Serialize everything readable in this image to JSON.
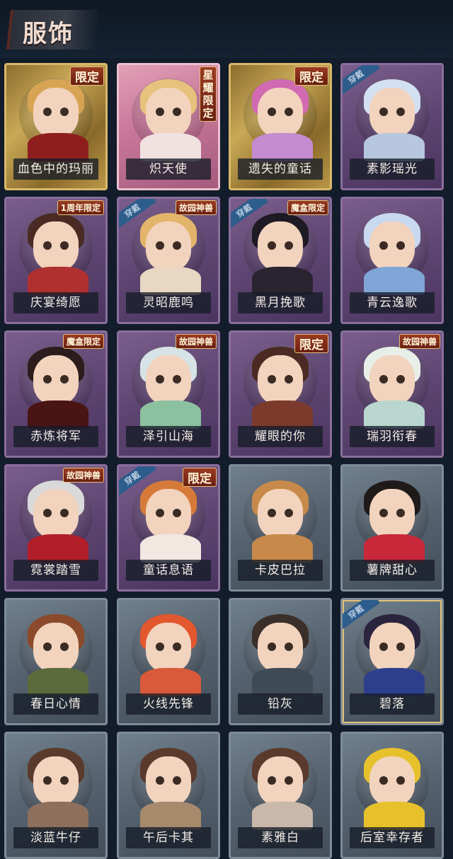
{
  "header": {
    "title": "服饰"
  },
  "cards": [
    {
      "name": "血色中的玛丽",
      "style": "gold",
      "tag": "限定",
      "hair": "#d7a454",
      "body": "#8e1e1e"
    },
    {
      "name": "炽天使",
      "style": "pink",
      "tag": "星耀限定",
      "tagVertical": true,
      "hair": "#e6c27c",
      "body": "#f1e1e1"
    },
    {
      "name": "遗失的童话",
      "style": "gold",
      "tag": "限定",
      "hair": "#d16ab2",
      "body": "#c58bd0"
    },
    {
      "name": "素影瑶光",
      "style": "purple",
      "wear": "穿戴",
      "hair": "#d3e0f2",
      "body": "#b6c7df"
    },
    {
      "name": "庆宴绮愿",
      "style": "purple",
      "tag": "1周年限定",
      "tagSmall": true,
      "hair": "#4a2b24",
      "body": "#b03030"
    },
    {
      "name": "灵昭鹿鸣",
      "style": "purple",
      "wear": "穿戴",
      "tag": "故园神兽",
      "tagSmall": true,
      "hair": "#e2b56a",
      "body": "#e8d7c2"
    },
    {
      "name": "黑月挽歌",
      "style": "purple",
      "wear": "穿戴",
      "tag": "魔盒限定",
      "tagSmall": true,
      "hair": "#1e1a24",
      "body": "#2a2330"
    },
    {
      "name": "青云逸歌",
      "style": "purple",
      "hair": "#c8d8ee",
      "body": "#7fa6d6"
    },
    {
      "name": "赤炼将军",
      "style": "purple",
      "tag": "魔盒限定",
      "tagSmall": true,
      "hair": "#2c1c1c",
      "body": "#4a1414"
    },
    {
      "name": "泽引山海",
      "style": "purple",
      "tag": "故园神兽",
      "tagSmall": true,
      "hair": "#d6e3e6",
      "body": "#8cc1a0"
    },
    {
      "name": "耀眼的你",
      "style": "purple",
      "tag": "限定",
      "hair": "#4a2a22",
      "body": "#7b3a2b"
    },
    {
      "name": "瑞羽衔春",
      "style": "purple",
      "tag": "故园神兽",
      "tagSmall": true,
      "hair": "#e8efe9",
      "body": "#b9d6cf"
    },
    {
      "name": "霓裳踏雪",
      "style": "purple",
      "tag": "故园神兽",
      "tagSmall": true,
      "hair": "#d9d9d9",
      "body": "#b21e2a"
    },
    {
      "name": "童话息语",
      "style": "purple",
      "wear": "穿戴",
      "tag": "限定",
      "hair": "#d67a3a",
      "body": "#f1e8e2"
    },
    {
      "name": "卡皮巴拉",
      "style": "gray",
      "hair": "#c78a4a",
      "body": "#c78a4a"
    },
    {
      "name": "薯牌甜心",
      "style": "gray",
      "hair": "#1e1a1a",
      "body": "#c9273a"
    },
    {
      "name": "春日心情",
      "style": "gray",
      "hair": "#8b4a2b",
      "body": "#5c6b3c"
    },
    {
      "name": "火线先锋",
      "style": "gray",
      "hair": "#e3572f",
      "body": "#d95a3a"
    },
    {
      "name": "铅灰",
      "style": "gray",
      "hair": "#3b2f29",
      "body": "#3f4a57"
    },
    {
      "name": "碧落",
      "style": "gray",
      "wear": "穿戴",
      "goldEdge": true,
      "hair": "#2b243f",
      "body": "#2d3f8c"
    },
    {
      "name": "淡蓝牛仔",
      "style": "gray",
      "hair": "#5a3a2c",
      "body": "#8d6f5b"
    },
    {
      "name": "午后卡其",
      "style": "gray",
      "hair": "#5a3a2c",
      "body": "#a78a6b"
    },
    {
      "name": "素雅白",
      "style": "gray",
      "hair": "#5a3a2c",
      "body": "#c9b8aa"
    },
    {
      "name": "后室幸存者",
      "style": "gray",
      "hair": "#e7c12c",
      "body": "#e7c12c"
    }
  ]
}
